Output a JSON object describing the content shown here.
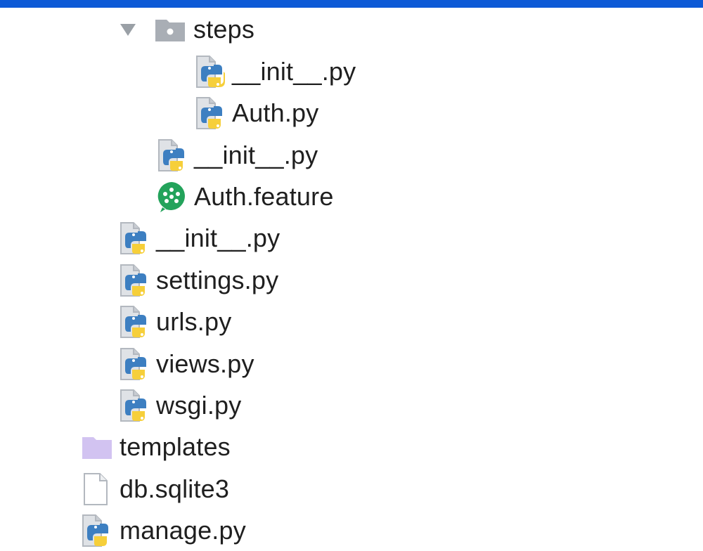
{
  "colors": {
    "topbar": "#0d5ad6",
    "text": "#1f1f1f",
    "folder_gray": "#a9aeb5",
    "folder_purple": "#d2c3f1",
    "python_blue": "#3d7fc1",
    "python_yellow": "#f6cf3a",
    "cucumber_green": "#23a35b"
  },
  "tree": {
    "rows": [
      {
        "label": "steps",
        "icon": "folder-icon",
        "expanded": true
      },
      {
        "label": "__init__.py",
        "icon": "python-file-icon"
      },
      {
        "label": "Auth.py",
        "icon": "python-file-icon"
      },
      {
        "label": "__init__.py",
        "icon": "python-file-icon"
      },
      {
        "label": "Auth.feature",
        "icon": "cucumber-icon"
      },
      {
        "label": "__init__.py",
        "icon": "python-file-icon"
      },
      {
        "label": "settings.py",
        "icon": "python-file-icon"
      },
      {
        "label": "urls.py",
        "icon": "python-file-icon"
      },
      {
        "label": "views.py",
        "icon": "python-file-icon"
      },
      {
        "label": "wsgi.py",
        "icon": "python-file-icon"
      },
      {
        "label": "templates",
        "icon": "template-folder-icon"
      },
      {
        "label": "db.sqlite3",
        "icon": "text-file-icon"
      },
      {
        "label": "manage.py",
        "icon": "python-file-icon"
      }
    ]
  }
}
